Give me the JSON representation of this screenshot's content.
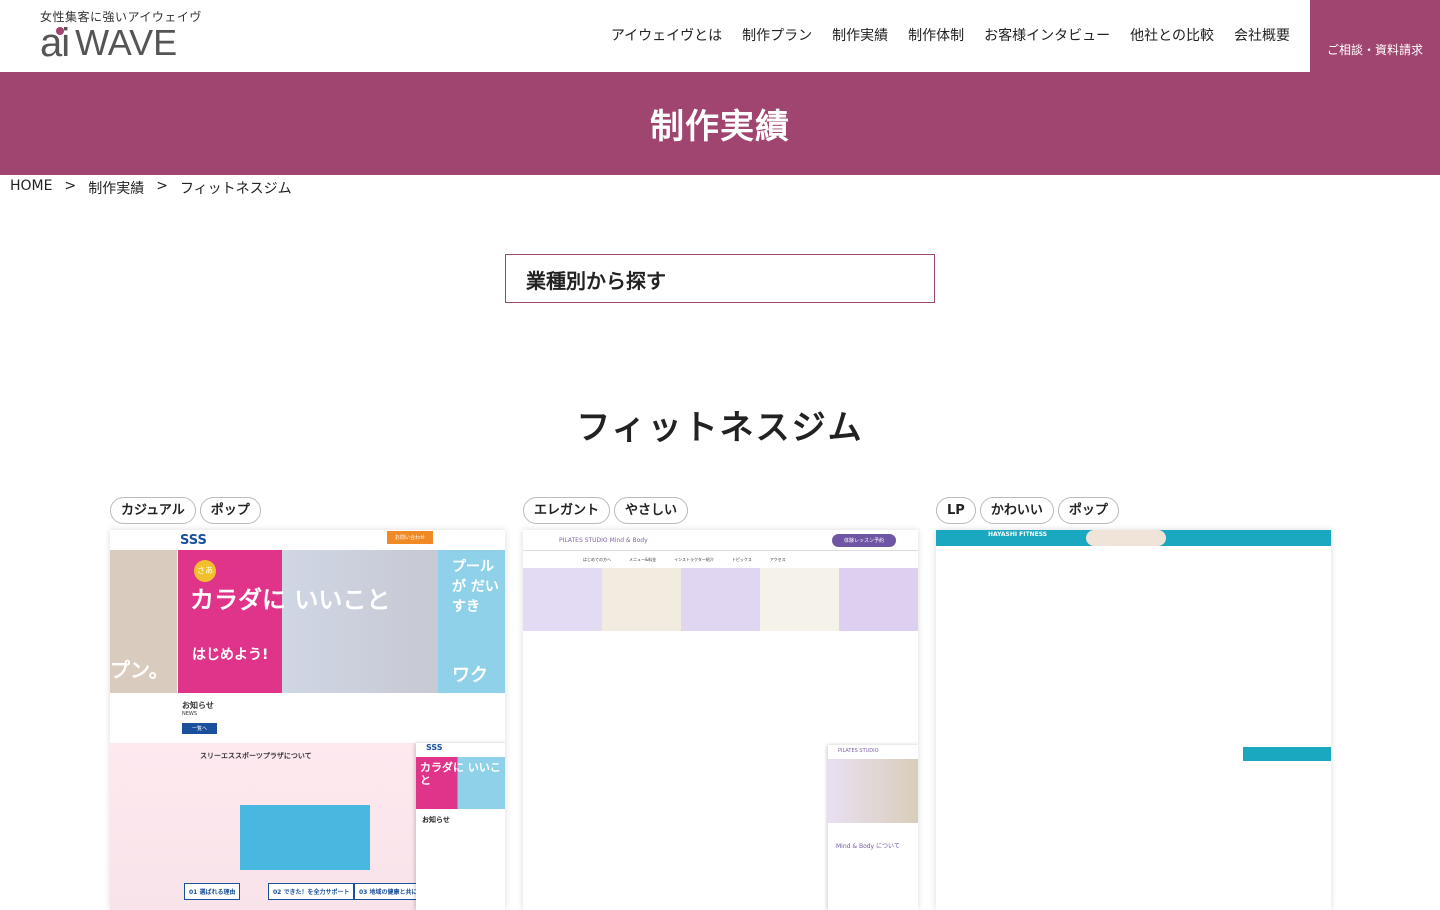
{
  "header": {
    "tagline": "女性集客に強いアイウェイヴ",
    "logo_ai": "ai",
    "logo_wave": "WAVE",
    "nav": [
      "アイウェイヴとは",
      "制作プラン",
      "制作実績",
      "制作体制",
      "お客様インタビュー",
      "他社との比較",
      "会社概要"
    ],
    "cta": "ご相談・資料請求"
  },
  "banner": {
    "title": "制作実績"
  },
  "breadcrumb": {
    "home": "HOME",
    "sep": ">",
    "level1": "制作実績",
    "current": "フィットネスジム"
  },
  "search": {
    "label": "業種別から探す"
  },
  "section": {
    "title": "フィットネスジム"
  },
  "cards": [
    {
      "tags": [
        "カジュアル",
        "ポップ"
      ],
      "thumb": {
        "logo": "SSS",
        "contact": "お問い合わせ",
        "badge": "さあ",
        "headline": "カラダに いいこと",
        "sub": "はじめよう!",
        "left_text": "プン。",
        "right_top": "プールが だいすき",
        "right_bottom": "ワク",
        "news_title": "お知らせ",
        "news_sub": "NEWS",
        "news_btn": "一覧へ",
        "about": "スリーエススポーツプラザについて",
        "features": [
          "01 選ばれる理由",
          "02 できた！を全力サポート",
          "03 地域の健康と共に"
        ],
        "phone_logo": "SSS",
        "phone_hero": "カラダに いいこと",
        "phone_news": "お知らせ"
      },
      "colors": {
        "primary": "#1a4f9c",
        "accent": "#e0348b",
        "orange": "#f08a24"
      }
    },
    {
      "tags": [
        "エレガント",
        "やさしい"
      ],
      "thumb": {
        "logo": "PILATES STUDIO Mind & Body",
        "book": "体験レッスン予約",
        "nav": [
          "はじめての方へ",
          "メニュー&料金",
          "インストラクター紹介",
          "トピックス",
          "アクセス"
        ],
        "phone_logo": "PILATES STUDIO",
        "phone_title": "Mind & Body について"
      },
      "colors": {
        "primary": "#6f56a5",
        "light": "#e8e0f2"
      }
    },
    {
      "tags": [
        "LP",
        "かわいい",
        "ポップ"
      ],
      "thumb": {
        "name": "HAYASHI FITNESS"
      },
      "colors": {
        "primary": "#1aa7c0"
      }
    }
  ],
  "brand_color": "#a0456f"
}
